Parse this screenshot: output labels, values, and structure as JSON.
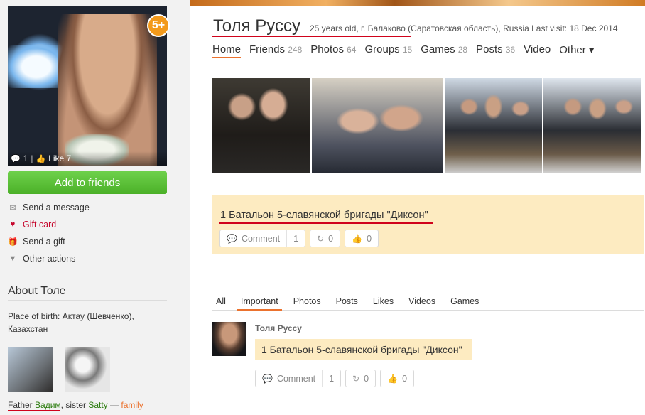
{
  "profile": {
    "name": "Толя Руссу",
    "meta": "25 years old, г. Балаково (Саратовская область), Russia  Last visit: 18 Dec 2014",
    "avatar_badge": "5+",
    "avatar_comments": "1",
    "avatar_likes": "Like 7"
  },
  "sidebar": {
    "add_friends": "Add to friends",
    "actions": [
      {
        "label": "Send a message",
        "icon": "envelope-icon"
      },
      {
        "label": "Gift card",
        "icon": "gift-card-icon"
      },
      {
        "label": "Send a gift",
        "icon": "gift-icon"
      },
      {
        "label": "Other actions",
        "icon": "triangle-down-icon"
      }
    ],
    "about_title": "About Толе",
    "place_of_birth": "Place of birth: Актау (Шевченко), Казахстан",
    "family": {
      "prefix1": "Father ",
      "father": "Вадим",
      "sep": ", sister ",
      "sister": "Satty",
      "dash": " — ",
      "family_link": "family"
    }
  },
  "nav": [
    {
      "label": "Home",
      "count": ""
    },
    {
      "label": "Friends",
      "count": "248"
    },
    {
      "label": "Photos",
      "count": "64"
    },
    {
      "label": "Groups",
      "count": "15"
    },
    {
      "label": "Games",
      "count": "28"
    },
    {
      "label": "Posts",
      "count": "36"
    },
    {
      "label": "Video",
      "count": ""
    },
    {
      "label": "Other ▾",
      "count": ""
    }
  ],
  "status": {
    "text": "1 Батальон 5-славянской бригады \"Диксон\"",
    "comment_label": "Comment",
    "comment_count": "1",
    "share_count": "0",
    "like_count": "0"
  },
  "tabs": [
    "All",
    "Important",
    "Photos",
    "Posts",
    "Likes",
    "Videos",
    "Games"
  ],
  "feed": {
    "author": "Толя Руссу",
    "text": "1 Батальон 5-славянской бригады \"Диксон\"",
    "comment_label": "Comment",
    "comment_count": "1",
    "share_count": "0",
    "like_count": "0"
  },
  "colors": {
    "accent": "#eb722e",
    "green_button": "#4bb028",
    "status_bg": "#fdebc1",
    "link_green": "#2a7b0d",
    "gift_red": "#c6082e"
  }
}
